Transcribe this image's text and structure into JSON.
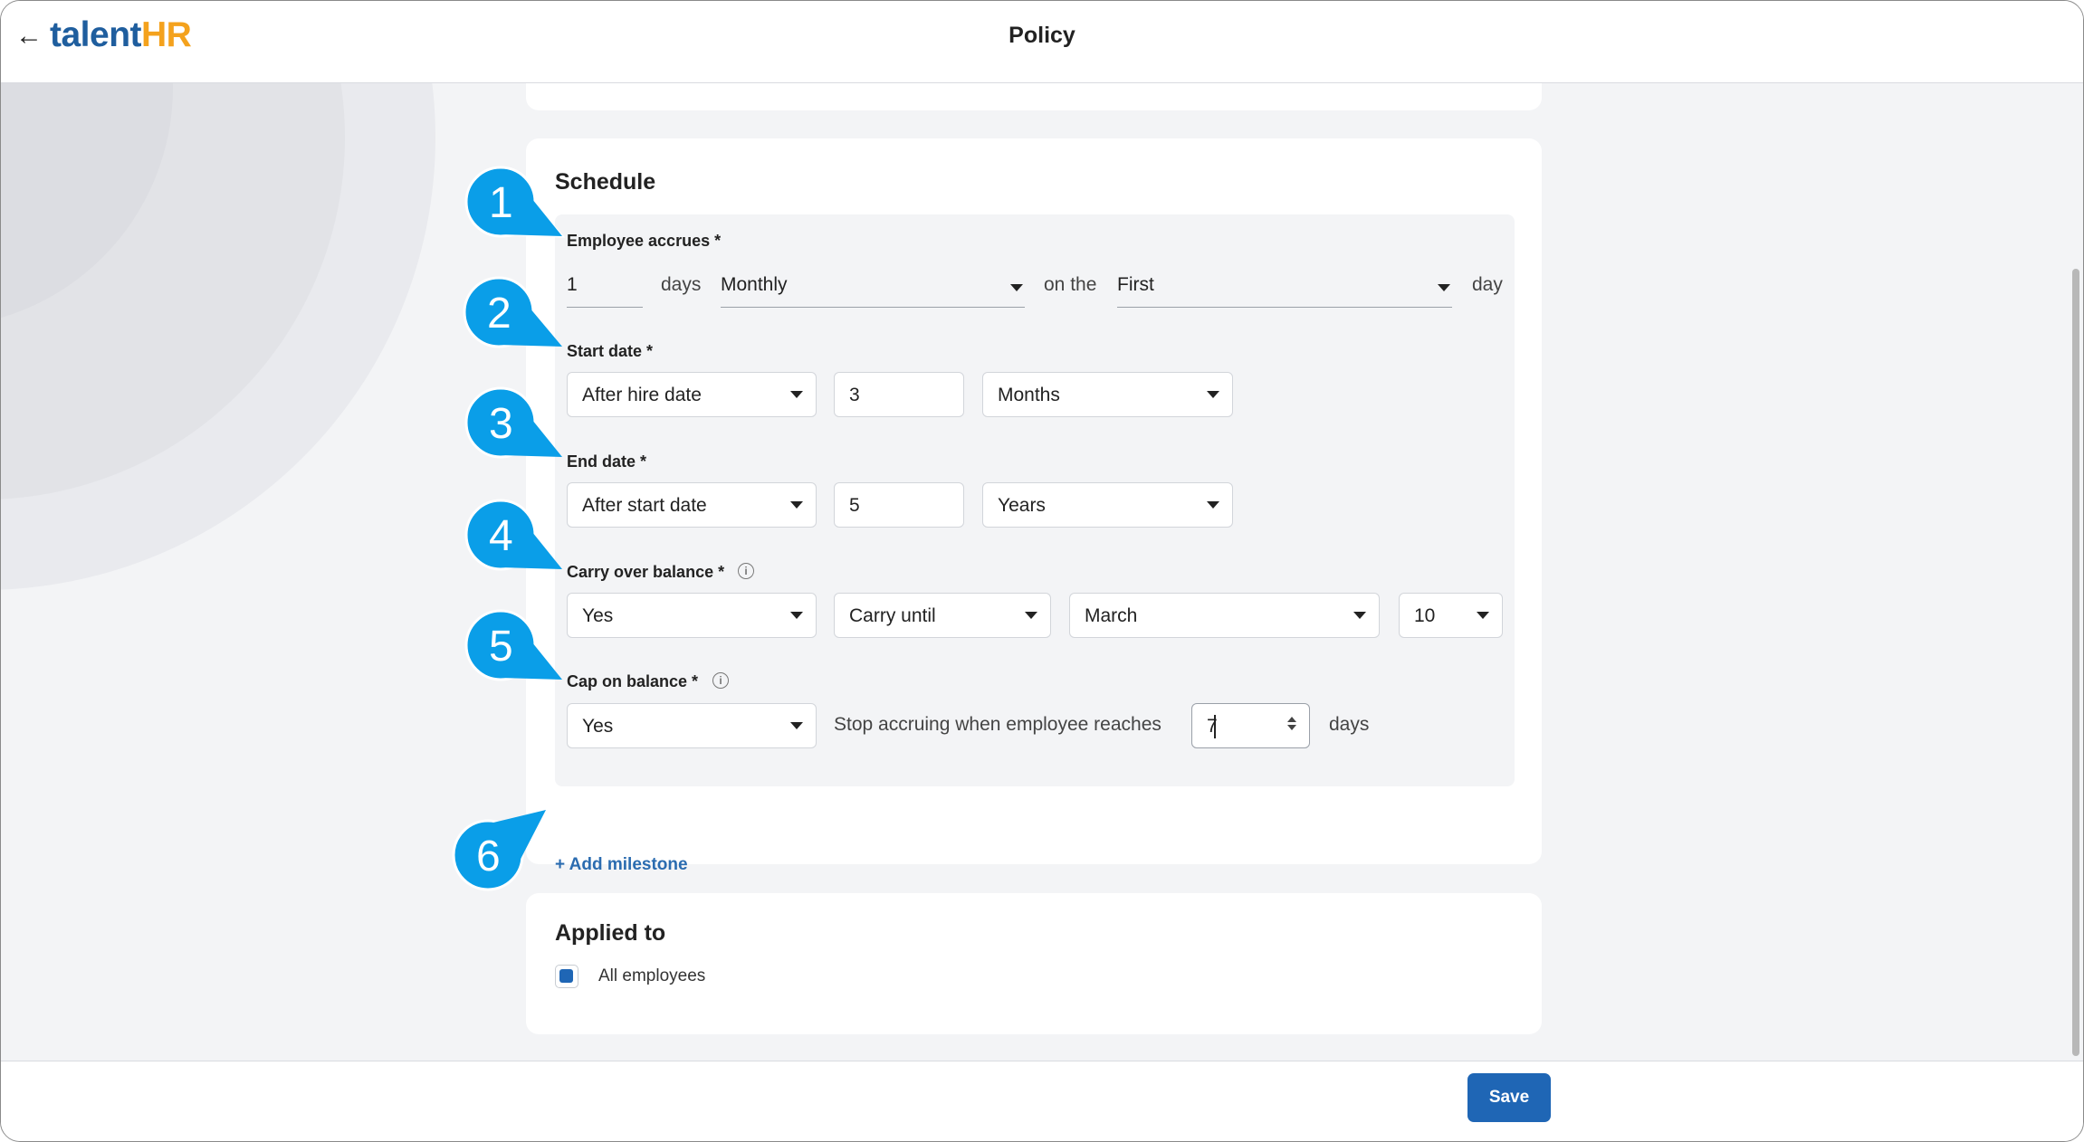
{
  "app": {
    "brand_part1": "talent",
    "brand_part2": "HR",
    "page_title": "Policy"
  },
  "schedule": {
    "heading": "Schedule",
    "accrues": {
      "label": "Employee accrues *",
      "amount": "1",
      "unit": "days",
      "frequency": "Monthly",
      "on_the": "on the",
      "day_option": "First",
      "day_suffix": "day"
    },
    "start_date": {
      "label": "Start date *",
      "basis": "After hire date",
      "amount": "3",
      "unit": "Months"
    },
    "end_date": {
      "label": "End date *",
      "basis": "After start date",
      "amount": "5",
      "unit": "Years"
    },
    "carry_over": {
      "label": "Carry over balance *",
      "info_icon": "i",
      "enabled": "Yes",
      "mode": "Carry until",
      "month": "March",
      "day": "10"
    },
    "cap": {
      "label": "Cap on balance *",
      "info_icon": "i",
      "enabled": "Yes",
      "text": "Stop accruing when employee reaches",
      "value": "7",
      "suffix": "days"
    },
    "add_milestone": "+ Add milestone"
  },
  "applied_to": {
    "heading": "Applied to",
    "all_employees_label": "All employees",
    "all_employees_checked": true
  },
  "footer": {
    "save_label": "Save"
  },
  "callouts": [
    "1",
    "2",
    "3",
    "4",
    "5",
    "6"
  ],
  "colors": {
    "accent": "#1f66b5",
    "callout": "#0a9ee8",
    "brand_blue": "#1f5e9e",
    "brand_orange": "#f4a21d"
  },
  "icons": {
    "back": "arrow-left-icon",
    "dropdown": "caret-down-icon",
    "info": "info-icon",
    "spinner": "spinner-arrows-icon"
  }
}
